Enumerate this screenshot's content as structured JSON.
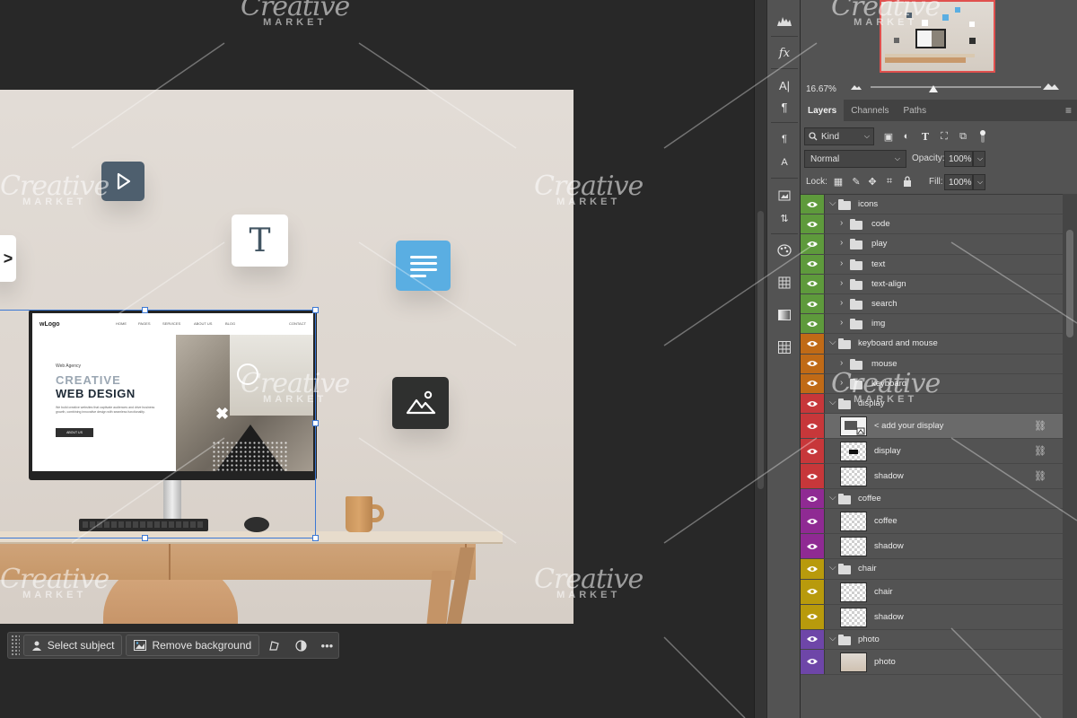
{
  "context_bar": {
    "select_subject": "Select subject",
    "remove_background": "Remove background",
    "more": "•••"
  },
  "screen": {
    "logo": "wLogo",
    "nav": [
      "HOME",
      "PAGES",
      "SERVICES",
      "ABOUT US",
      "BLOG",
      "CONTACT"
    ],
    "agency": "Web Agency",
    "headline1": "CREATIVE",
    "headline2": "WEB DESIGN",
    "body": "We build creative websites that captivate audiences and drive business growth, combining innovative design with seamless functionality.",
    "button": "ABOUT US"
  },
  "tiles": {
    "text_glyph": "T",
    "code_glyph": ">"
  },
  "navigator": {
    "zoom": "16.67%"
  },
  "panel": {
    "tabs": [
      "Layers",
      "Channels",
      "Paths"
    ],
    "filter_kind": "Kind",
    "blend_mode": "Normal",
    "opacity_label": "Opacity:",
    "opacity_value": "100%",
    "lock_label": "Lock:",
    "fill_label": "Fill:",
    "fill_value": "100%"
  },
  "layers": [
    {
      "name": "icons",
      "type": "group",
      "color": "#5e9a3c",
      "expanded": true
    },
    {
      "name": "code",
      "type": "group",
      "color": "#5e9a3c",
      "child": true
    },
    {
      "name": "play",
      "type": "group",
      "color": "#5e9a3c",
      "child": true
    },
    {
      "name": "text",
      "type": "group",
      "color": "#5e9a3c",
      "child": true
    },
    {
      "name": "text-align",
      "type": "group",
      "color": "#5e9a3c",
      "child": true
    },
    {
      "name": "search",
      "type": "group",
      "color": "#5e9a3c",
      "child": true
    },
    {
      "name": "img",
      "type": "group",
      "color": "#5e9a3c",
      "child": true
    },
    {
      "name": "keyboard and mouse",
      "type": "group",
      "color": "#c06a16",
      "expanded": true
    },
    {
      "name": "mouse",
      "type": "group",
      "color": "#c06a16",
      "child": true
    },
    {
      "name": "keyboard",
      "type": "group",
      "color": "#c06a16",
      "child": true
    },
    {
      "name": "display",
      "type": "group",
      "color": "#c7373a",
      "expanded": true
    },
    {
      "name": "< add your display",
      "type": "smart",
      "color": "#c7373a",
      "selected": true,
      "linked": true
    },
    {
      "name": "display",
      "type": "layer",
      "color": "#c7373a",
      "linked": true
    },
    {
      "name": "shadow",
      "type": "layer",
      "color": "#c7373a",
      "linked": true
    },
    {
      "name": "coffee",
      "type": "group",
      "color": "#8f2a93",
      "expanded": true
    },
    {
      "name": "coffee",
      "type": "layer",
      "color": "#8f2a93"
    },
    {
      "name": "shadow",
      "type": "layer",
      "color": "#8f2a93"
    },
    {
      "name": "chair",
      "type": "group",
      "color": "#b89a0c",
      "expanded": true
    },
    {
      "name": "chair",
      "type": "layer",
      "color": "#b89a0c"
    },
    {
      "name": "shadow",
      "type": "layer",
      "color": "#b89a0c"
    },
    {
      "name": "photo",
      "type": "group",
      "color": "#6e46a8",
      "expanded": true
    },
    {
      "name": "photo",
      "type": "layer",
      "color": "#6e46a8"
    }
  ],
  "watermark": {
    "brand": "Creative",
    "sub": "MARKET"
  },
  "colors": {
    "accent_selection": "#3b78d4",
    "group_green": "#5e9a3c",
    "group_orange": "#c06a16",
    "group_red": "#c7373a",
    "group_purple": "#8f2a93",
    "group_yellow": "#b89a0c",
    "group_violet": "#6e46a8"
  }
}
